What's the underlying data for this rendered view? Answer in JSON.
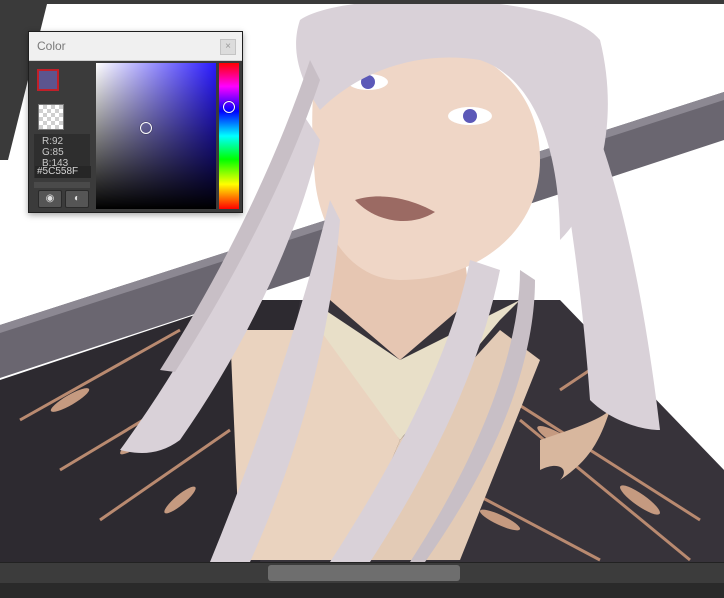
{
  "panel": {
    "title": "Color",
    "close_glyph": "×",
    "close_icon": "close-icon",
    "color_rgb": {
      "r": "R:92",
      "g": "G:85",
      "b": "B:143"
    },
    "hex": "#5C558F",
    "foreground_color": "#5c558f",
    "background_color": "#000000",
    "swatch_border_color": "#c0202a",
    "buttons": [
      {
        "name": "palette-button",
        "glyph": "🎨",
        "icon": "palette-icon"
      },
      {
        "name": "palette-swap-button",
        "glyph": "🎨",
        "icon": "palette-swap-icon"
      }
    ]
  },
  "canvas": {
    "description_icon": "artwork-canvas"
  },
  "scrollbar": {
    "thumb_fraction": 0.27
  }
}
